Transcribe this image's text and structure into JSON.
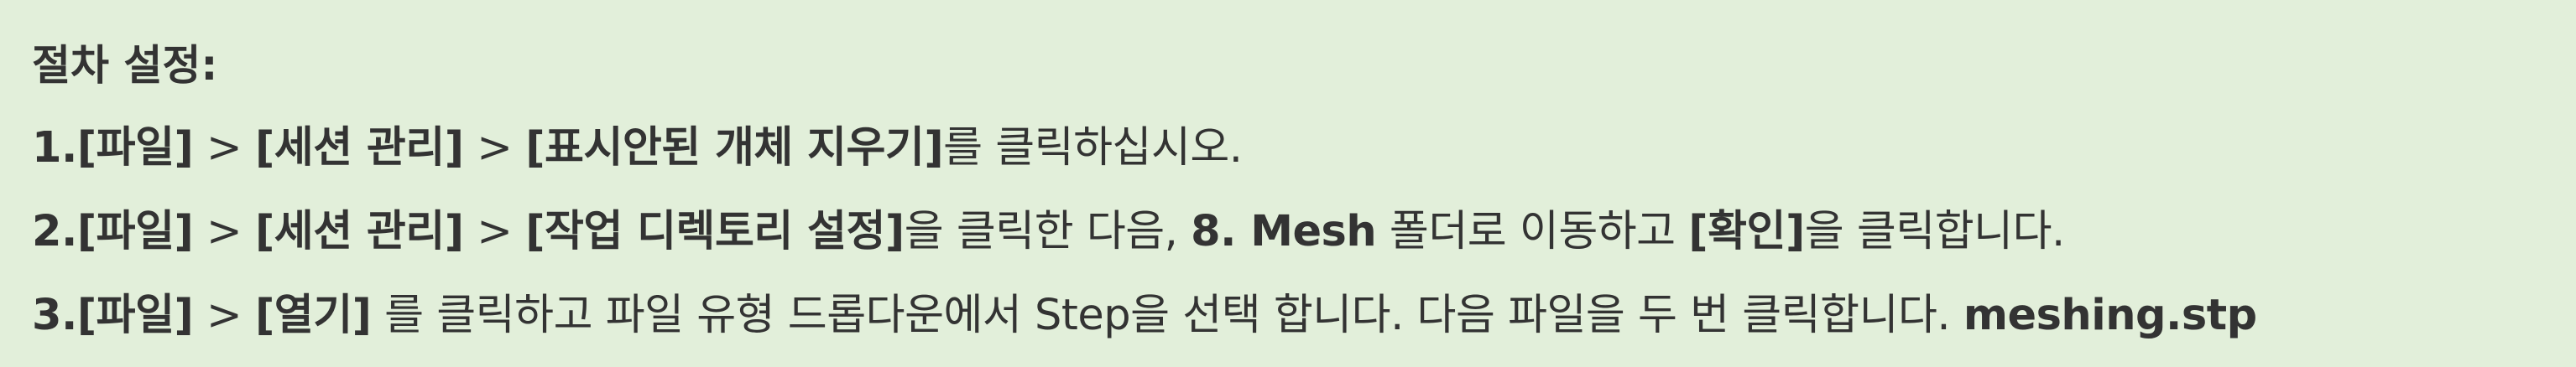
{
  "heading": "절차 설정:",
  "steps": [
    {
      "number": "1.",
      "m1": "[파일]",
      "sep1": " > ",
      "m2": "[세션 관리]",
      "sep2": " > ",
      "m3": "[표시안된 개체 지우기]",
      "tail": "를 클릭하십시오."
    },
    {
      "number": "2.",
      "m1": "[파일]",
      "sep1": " > ",
      "m2": "[세션 관리]",
      "sep2": " > ",
      "m3": "[작업 디렉토리 설정]",
      "mid": "을 클릭한 다음, ",
      "folder": "8. Mesh",
      "mid2": " 폴더로 이동하고 ",
      "confirm": "[확인]",
      "tail": "을 클릭합니다."
    },
    {
      "number": "3.",
      "m1": "[파일]",
      "sep1": " > ",
      "m2": "[열기]",
      "tail": " 를 클릭하고 파일 유형 드롭다운에서 Step을 선택 합니다. 다음 파일을 두 번 클릭합니다. ",
      "file": "meshing.stp"
    }
  ]
}
